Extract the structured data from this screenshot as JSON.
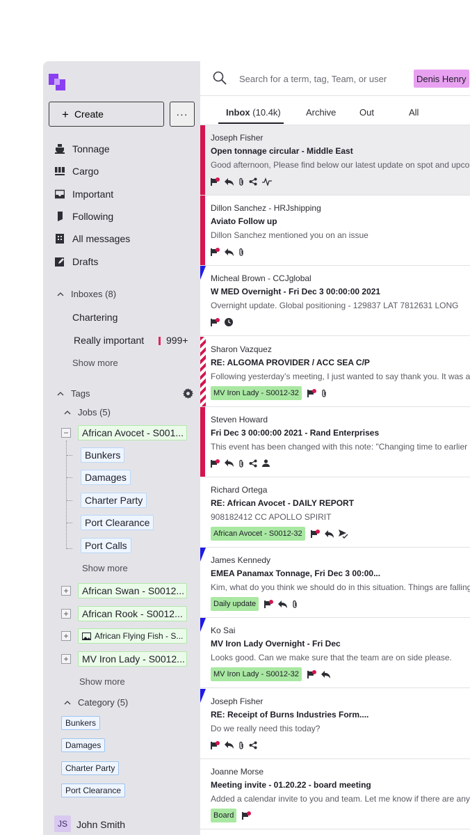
{
  "sidebar": {
    "create_label": "Create",
    "more_label": "···",
    "nav": [
      {
        "label": "Tonnage",
        "icon": "ship-icon"
      },
      {
        "label": "Cargo",
        "icon": "containers-icon"
      },
      {
        "label": "Important",
        "icon": "inbox-tray-icon"
      },
      {
        "label": "Following",
        "icon": "bookmark-icon"
      },
      {
        "label": "All messages",
        "icon": "building-icon"
      },
      {
        "label": "Drafts",
        "icon": "draft-edit-icon"
      }
    ],
    "inboxes": {
      "title": "Inboxes (8)",
      "items": [
        {
          "label": "Chartering",
          "count": ""
        },
        {
          "label": "Really important",
          "count": "999+"
        }
      ],
      "show_more": "Show more"
    },
    "tags": {
      "title": "Tags",
      "jobs_title": "Jobs (5)",
      "jobs": [
        {
          "label": "African Avocet - S001...",
          "expanded": true
        },
        {
          "label": "African Swan - S0012..."
        },
        {
          "label": "African Rook - S0012..."
        },
        {
          "label": "African Flying Fish - S...",
          "icon": "image-icon"
        },
        {
          "label": "MV Iron Lady - S0012..."
        }
      ],
      "sub_tags": [
        "Bunkers",
        "Damages",
        "Charter Party",
        "Port Clearance",
        "Port Calls"
      ],
      "sub_show_more": "Show more",
      "jobs_show_more": "Show more",
      "category_title": "Category (5)",
      "category": [
        "Bunkers",
        "Damages",
        "Charter Party",
        "Port Clearance"
      ]
    },
    "user": {
      "initials": "JS",
      "name": "John Smith"
    }
  },
  "search": {
    "placeholder": "Search for a term, tag, Team, or user",
    "user_pill": "Denis Henry"
  },
  "tabs": [
    {
      "label": "Inbox",
      "count": "(10.4k)",
      "active": true
    },
    {
      "label": "Archive"
    },
    {
      "label": "Out"
    },
    {
      "label": "All"
    }
  ],
  "messages": [
    {
      "sender": "Joseph Fisher",
      "subject": "Open tonnage circular - Middle East",
      "preview": "Good afternoon, Please find below our latest update on spot and upcoming",
      "tag": "",
      "marker": "red",
      "selected": true,
      "icons": [
        "flag-dot-icon",
        "reply-icon",
        "paperclip-icon",
        "share-icon",
        "activity-icon"
      ]
    },
    {
      "sender": "Dillon Sanchez - HRJshipping",
      "subject": "Aviato Follow up",
      "preview": "Dillon Sanchez mentioned you on an issue",
      "tag": "",
      "marker": "red",
      "icons": [
        "flag-dot-icon",
        "reply-icon",
        "paperclip-icon"
      ]
    },
    {
      "sender": "Micheal Brown - CCJglobal",
      "subject": "W MED Overnight - Fri Dec  3 00:00:00 2021",
      "preview": "Overnight update. Global positioning - 129837 LAT 7812631 LONG",
      "tag": "",
      "marker": "blue",
      "icons": [
        "flag-dot-icon",
        "clock-icon"
      ]
    },
    {
      "sender": "Sharon Vazquez",
      "subject": "RE: ALGOMA PROVIDER / ACC SEA C/P",
      "preview": "Following yesterday’s meeting, I just wanted to say thank you. It was a pleasure",
      "tag": "MV Iron Lady - S0012-32",
      "marker": "stripe",
      "icons": [
        "flag-dot-icon",
        "paperclip-icon"
      ]
    },
    {
      "sender": "Steven Howard",
      "subject": "Fri Dec  3 00:00:00 2021 - Rand Enterprises",
      "preview": "This event has been changed with this note: \"Changing time to earlier",
      "tag": "",
      "marker": "red",
      "icons": [
        "flag-dot-icon",
        "reply-icon",
        "paperclip-icon",
        "share-icon",
        "person-icon"
      ]
    },
    {
      "sender": "Richard Ortega",
      "subject": "RE: African Avocet - DAILY REPORT",
      "preview": "908182412 CC APOLLO SPIRIT",
      "tag": "African Avocet - S0012-32",
      "marker": "none",
      "icons": [
        "flag-dot-icon",
        "reply-icon",
        "send-check-icon"
      ]
    },
    {
      "sender": "James Kennedy",
      "subject": "EMEA Panamax Tonnage, Fri Dec  3 00:00...",
      "preview": "Kim, what do you think we should do in this situation. Things are falling",
      "tag": "Daily update",
      "marker": "blue",
      "icons": [
        "flag-dot-icon",
        "reply-icon",
        "paperclip-icon"
      ]
    },
    {
      "sender": "Ko Sai",
      "subject": "MV Iron Lady Overnight - Fri Dec",
      "preview": "Looks good. Can we make sure that the team are on side please.",
      "tag": "MV Iron Lady - S0012-32",
      "marker": "blue",
      "icons": [
        "flag-dot-icon",
        "reply-icon"
      ]
    },
    {
      "sender": "Joseph Fisher",
      "subject": "RE: Receipt of Burns Industries Form....",
      "preview": "Do we really need this today?",
      "tag": "",
      "marker": "blue",
      "icons": [
        "flag-dot-icon",
        "reply-icon",
        "paperclip-icon",
        "share-icon"
      ]
    },
    {
      "sender": "Joanne Morse",
      "subject": "Meeting invite - 01.20.22 - board meeting",
      "preview": "Added a calendar invite to you and team. Let me know if there are any issues",
      "tag": "Board",
      "marker": "none",
      "icons": [
        "flag-dot-icon"
      ]
    }
  ],
  "colors": {
    "sidebar_bg": "#e4e4e8",
    "brand": "#8a3ff2",
    "marker_red": "#d4164f",
    "marker_blue": "#1f1ae6",
    "tag_green": "#a9e8a2",
    "user_pill": "#e8a1f0"
  }
}
